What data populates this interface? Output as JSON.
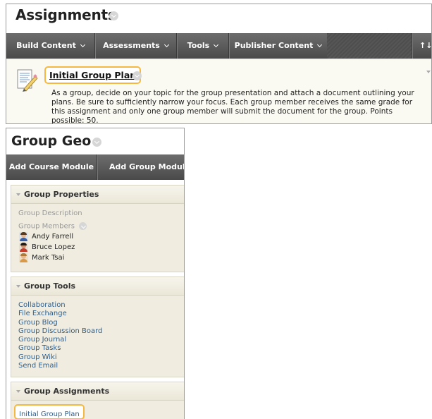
{
  "assignments_panel": {
    "title": "Assignments",
    "toolbar": {
      "items": [
        {
          "label": "Build Content"
        },
        {
          "label": "Assessments"
        },
        {
          "label": "Tools"
        },
        {
          "label": "Publisher Content"
        }
      ],
      "sort_label": "↑↓"
    },
    "item": {
      "icon": "assignment-document-icon",
      "title": "Initial Group Plan",
      "description": "As a group, decide on your topic for the group presentation and attach a document outlining your plans. Be sure to sufficiently narrow your focus. Each group member receives the same grade for this assignment and only one group member will submit the document for the group. Points possible: 50."
    }
  },
  "group_panel": {
    "title": "Group Geo",
    "toolbar": {
      "add_course_module": "Add Course Module",
      "add_group_module": "Add Group Module"
    },
    "group_properties": {
      "heading": "Group Properties",
      "description_label": "Group Description",
      "members_label": "Group Members",
      "members": [
        {
          "name": "Andy Farrell"
        },
        {
          "name": "Bruce Lopez"
        },
        {
          "name": "Mark Tsai"
        }
      ]
    },
    "group_tools": {
      "heading": "Group Tools",
      "links": [
        "Collaboration",
        "File Exchange",
        "Group Blog",
        "Group Discussion Board",
        "Group Journal",
        "Group Tasks",
        "Group Wiki",
        "Send Email"
      ]
    },
    "group_assignments": {
      "heading": "Group Assignments",
      "links": [
        "Initial Group Plan"
      ]
    }
  },
  "colors": {
    "toolbar_bg": "#555555",
    "highlight_border": "#f5b942",
    "link": "#2d5e8e",
    "module_bg": "#f0ede0",
    "item_row_bg": "#fbfaf2"
  }
}
